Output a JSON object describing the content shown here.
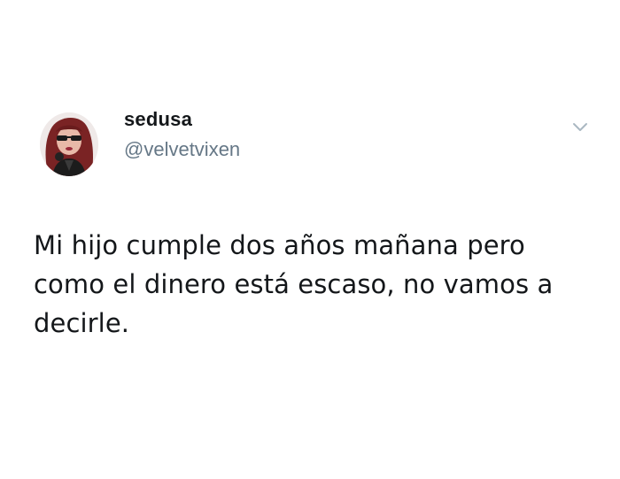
{
  "tweet": {
    "author": {
      "display_name": "sedusa",
      "handle": "@velvetvixen",
      "avatar_icon": "profile-avatar"
    },
    "menu_icon": "chevron-down-icon",
    "text": "Mi hijo cumple dos años mañana pero como el dinero está escaso, no vamos a decirle."
  },
  "colors": {
    "background": "#ffffff",
    "text_primary": "#14171a",
    "text_secondary": "#657786",
    "icon": "#aab8c2"
  }
}
